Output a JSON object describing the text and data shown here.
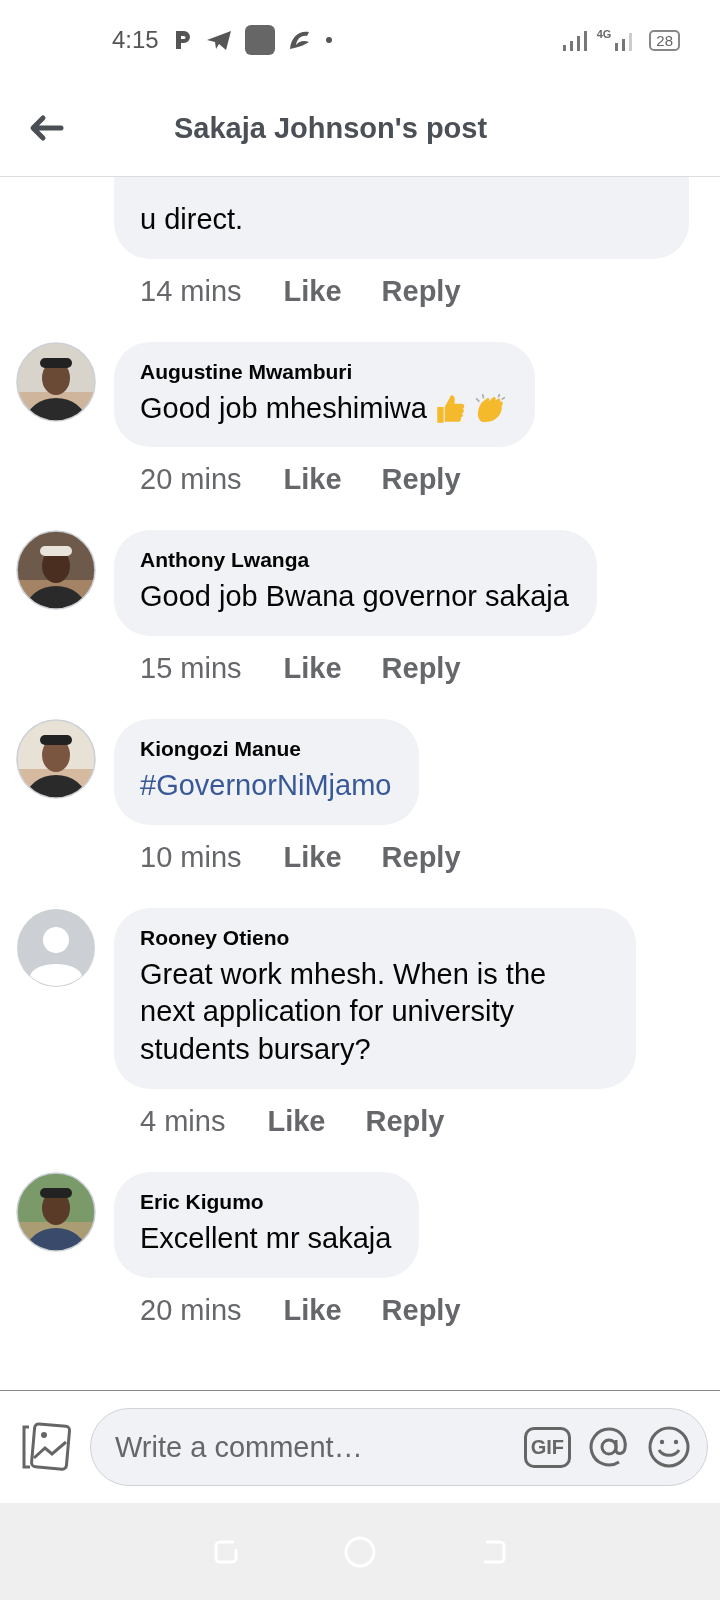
{
  "status_bar": {
    "time": "4:15",
    "network": "4G",
    "battery": "28"
  },
  "header": {
    "title": "Sakaja Johnson's post"
  },
  "partial_comment": {
    "text": "u direct.",
    "time": "14 mins",
    "like": "Like",
    "reply": "Reply"
  },
  "comments": [
    {
      "author": "Augustine Mwamburi",
      "text": "Good job mheshimiwa",
      "emojis": [
        {
          "kind": "thumbs-up"
        },
        {
          "kind": "clap"
        }
      ],
      "link": false,
      "time": "20 mins",
      "like": "Like",
      "reply": "Reply"
    },
    {
      "author": "Anthony Lwanga",
      "text": "Good job Bwana governor sakaja",
      "link": false,
      "time": "15 mins",
      "like": "Like",
      "reply": "Reply"
    },
    {
      "author": "Kiongozi Manue",
      "text": "#GovernorNiMjamo",
      "link": true,
      "time": "10 mins",
      "like": "Like",
      "reply": "Reply"
    },
    {
      "author": "Rooney Otieno",
      "text": "Great work mhesh. When is the next application for university students bursary?",
      "avatar": {
        "kind": "default"
      },
      "link": false,
      "time": "4 mins",
      "like": "Like",
      "reply": "Reply"
    },
    {
      "author": "Eric Kigumo",
      "text": "Excellent mr sakaja",
      "link": false,
      "time": "20 mins",
      "like": "Like",
      "reply": "Reply"
    }
  ],
  "composer": {
    "placeholder": "Write a comment…",
    "gif": "GIF"
  }
}
